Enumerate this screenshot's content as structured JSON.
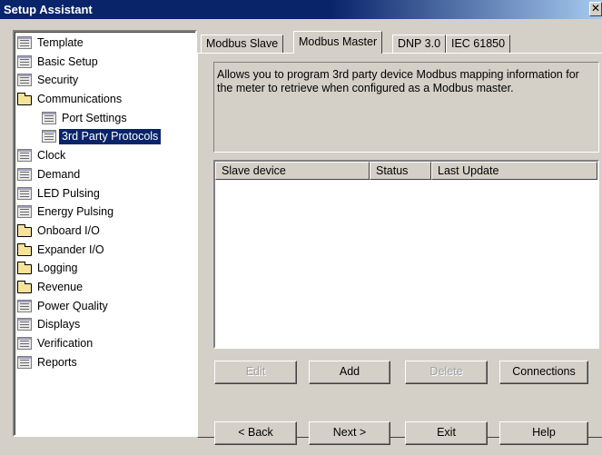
{
  "window": {
    "title": "Setup Assistant",
    "close_label": "✕"
  },
  "tree": {
    "items": [
      {
        "label": "Template",
        "icon": "doc-icon"
      },
      {
        "label": "Basic Setup",
        "icon": "doc-icon"
      },
      {
        "label": "Security",
        "icon": "doc-icon"
      },
      {
        "label": "Communications",
        "icon": "folder-icon"
      },
      {
        "label": "Port Settings",
        "icon": "doc-icon",
        "child": true
      },
      {
        "label": "3rd Party Protocols",
        "icon": "doc-icon",
        "child": true,
        "selected": true
      },
      {
        "label": "Clock",
        "icon": "doc-icon"
      },
      {
        "label": "Demand",
        "icon": "doc-icon"
      },
      {
        "label": "LED Pulsing",
        "icon": "doc-icon"
      },
      {
        "label": "Energy Pulsing",
        "icon": "doc-icon"
      },
      {
        "label": "Onboard I/O",
        "icon": "folder-icon"
      },
      {
        "label": "Expander I/O",
        "icon": "folder-icon"
      },
      {
        "label": "Logging",
        "icon": "folder-icon"
      },
      {
        "label": "Revenue",
        "icon": "folder-icon"
      },
      {
        "label": "Power Quality",
        "icon": "doc-icon"
      },
      {
        "label": "Displays",
        "icon": "doc-icon"
      },
      {
        "label": "Verification",
        "icon": "doc-icon"
      },
      {
        "label": "Reports",
        "icon": "doc-icon"
      }
    ]
  },
  "tabs": [
    {
      "label": "Modbus Slave"
    },
    {
      "label": "Modbus Master",
      "active": true
    },
    {
      "label": "DNP 3.0"
    },
    {
      "label": "IEC 61850"
    }
  ],
  "description": "Allows you to program 3rd party device Modbus mapping information for the meter to retrieve when configured as a Modbus master.",
  "list": {
    "columns": [
      "Slave device",
      "Status",
      "Last Update"
    ]
  },
  "actions": {
    "edit": "Edit",
    "add": "Add",
    "delete": "Delete",
    "connections": "Connections"
  },
  "nav": {
    "back": "< Back",
    "next": "Next >",
    "exit": "Exit",
    "help": "Help"
  }
}
